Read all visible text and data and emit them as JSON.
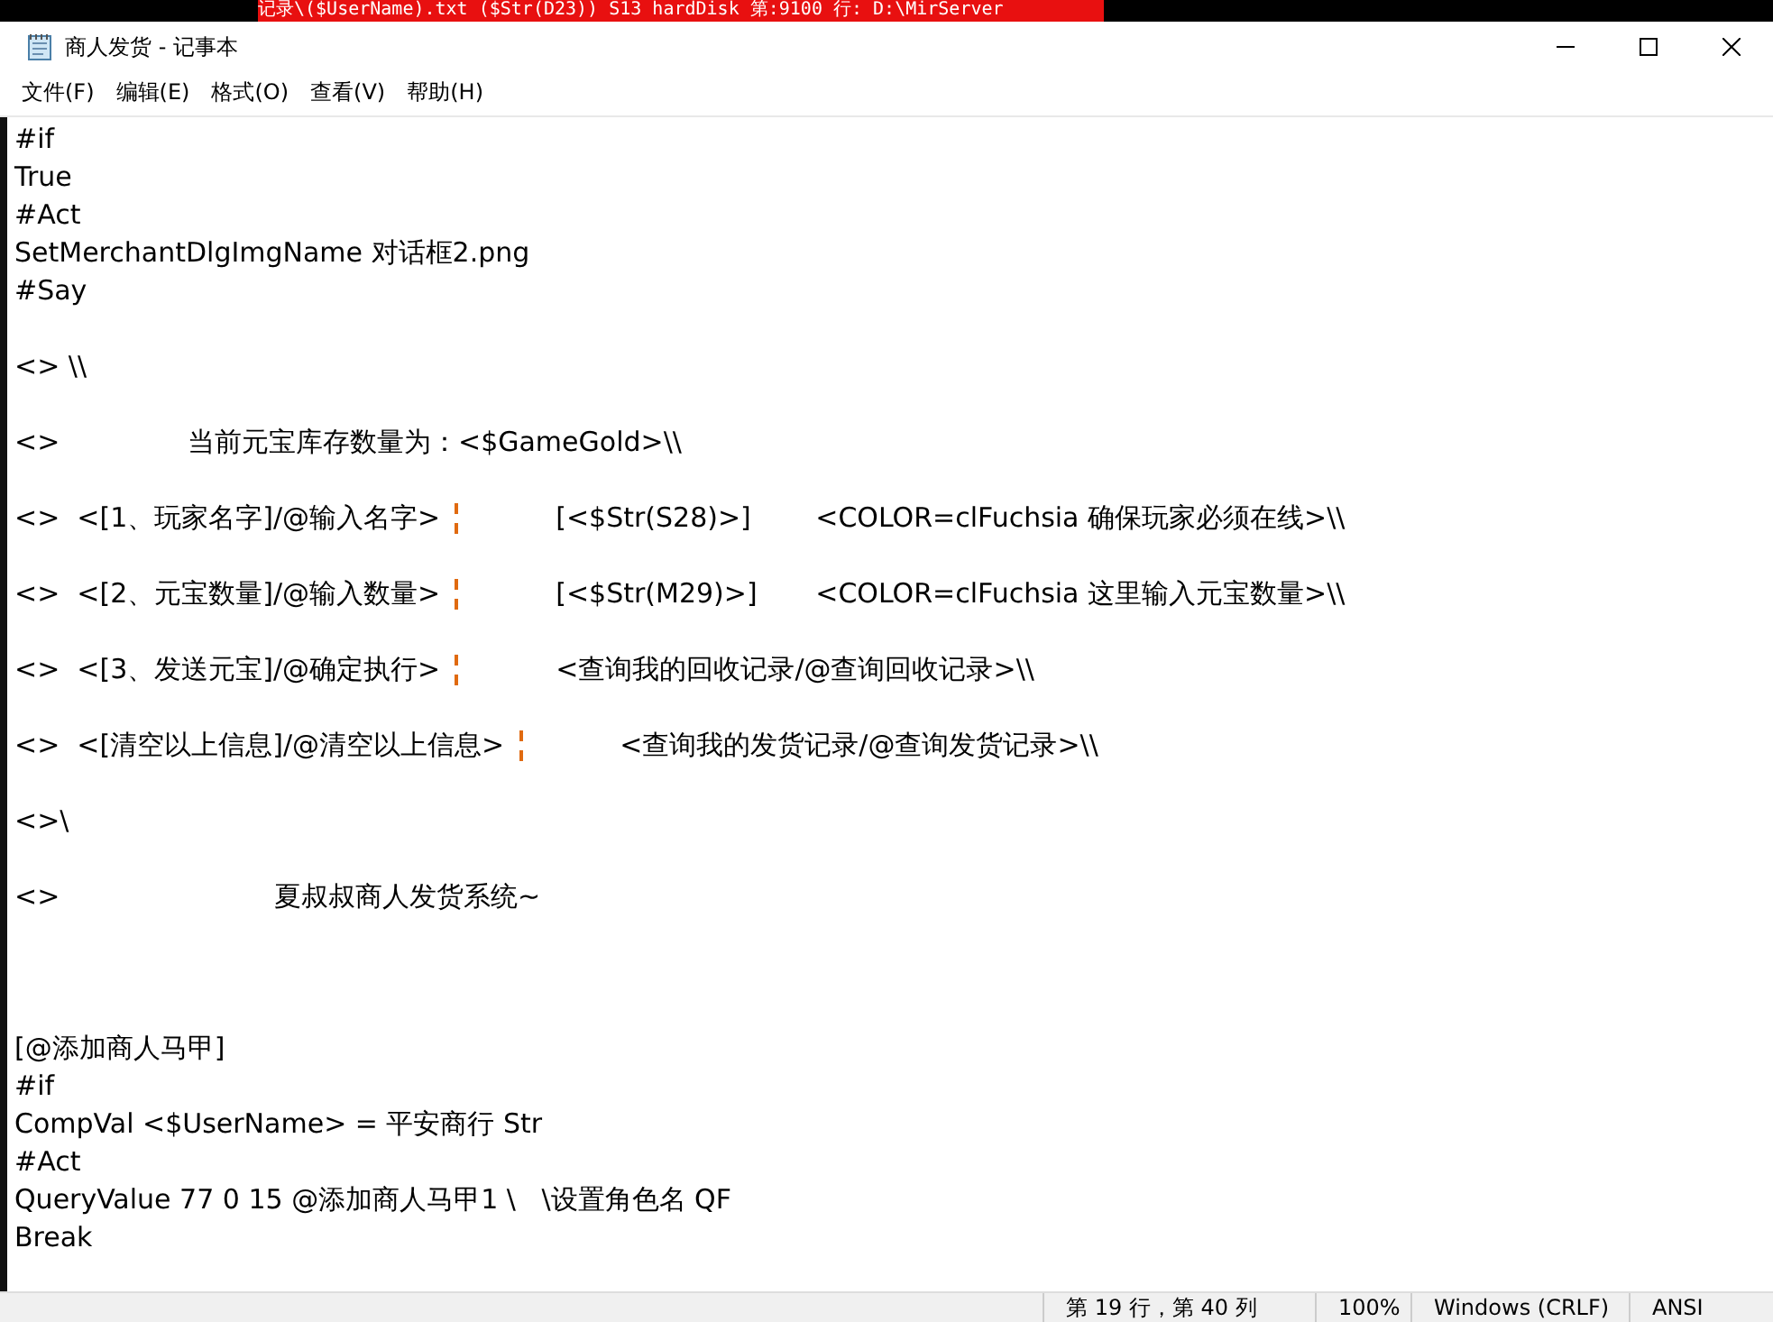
{
  "background_window": {
    "title": "记录\\($UserName).txt ($Str(D23)) S13 hardDisk 第:9100 行: D:\\MirServer"
  },
  "window": {
    "title": "商人发货 - 记事本"
  },
  "menu": [
    "文件(F)",
    "编辑(E)",
    "格式(O)",
    "查看(V)",
    "帮助(H)"
  ],
  "editor": {
    "lines": [
      {
        "kind": "text",
        "text": "#if"
      },
      {
        "kind": "text",
        "text": "True"
      },
      {
        "kind": "text",
        "text": "#Act"
      },
      {
        "kind": "text",
        "text": "SetMerchantDlgImgName 对话框2.png"
      },
      {
        "kind": "text",
        "text": "#Say"
      },
      {
        "kind": "blank"
      },
      {
        "kind": "text",
        "text": "<> \\\\"
      },
      {
        "kind": "blank"
      },
      {
        "kind": "text",
        "text": "<>\t\t当前元宝库存数量为：<$GameGold>\\\\"
      },
      {
        "kind": "blank"
      },
      {
        "kind": "split",
        "left": "<>  <[1、玩家名字]/@输入名字>",
        "right": "\t[<$Str(S28)>]\t<COLOR=clFuchsia 确保玩家必须在线>\\\\"
      },
      {
        "kind": "blank"
      },
      {
        "kind": "split",
        "left": "<>  <[2、元宝数量]/@输入数量>",
        "right": "\t[<$Str(M29)>]\t<COLOR=clFuchsia 这里输入元宝数量>\\\\"
      },
      {
        "kind": "blank"
      },
      {
        "kind": "split",
        "left": "<>  <[3、发送元宝]/@确定执行>",
        "right": "\t<查询我的回收记录/@查询回收记录>\\\\"
      },
      {
        "kind": "blank"
      },
      {
        "kind": "split",
        "left": "<>  <[清空以上信息]/@清空以上信息>",
        "right": "\t<查询我的发货记录/@查询发货记录>\\\\"
      },
      {
        "kind": "blank"
      },
      {
        "kind": "text",
        "text": "<>\\"
      },
      {
        "kind": "blank"
      },
      {
        "kind": "text",
        "text": "<>\t\t\t夏叔叔商人发货系统~"
      },
      {
        "kind": "blank"
      },
      {
        "kind": "blank"
      },
      {
        "kind": "blank"
      },
      {
        "kind": "text",
        "text": "[@添加商人马甲]"
      },
      {
        "kind": "text",
        "text": "#if"
      },
      {
        "kind": "text",
        "text": "CompVal <$UserName> = 平安商行 Str"
      },
      {
        "kind": "text",
        "text": "#Act"
      },
      {
        "kind": "text",
        "text": "QueryValue 77 0 15 @添加商人马甲1 \\   \\设置角色名 QF"
      },
      {
        "kind": "text",
        "text": "Break"
      }
    ]
  },
  "status_bar": [
    "第 19 行，第 40 列",
    "100%",
    "Windows (CRLF)",
    "ANSI"
  ]
}
